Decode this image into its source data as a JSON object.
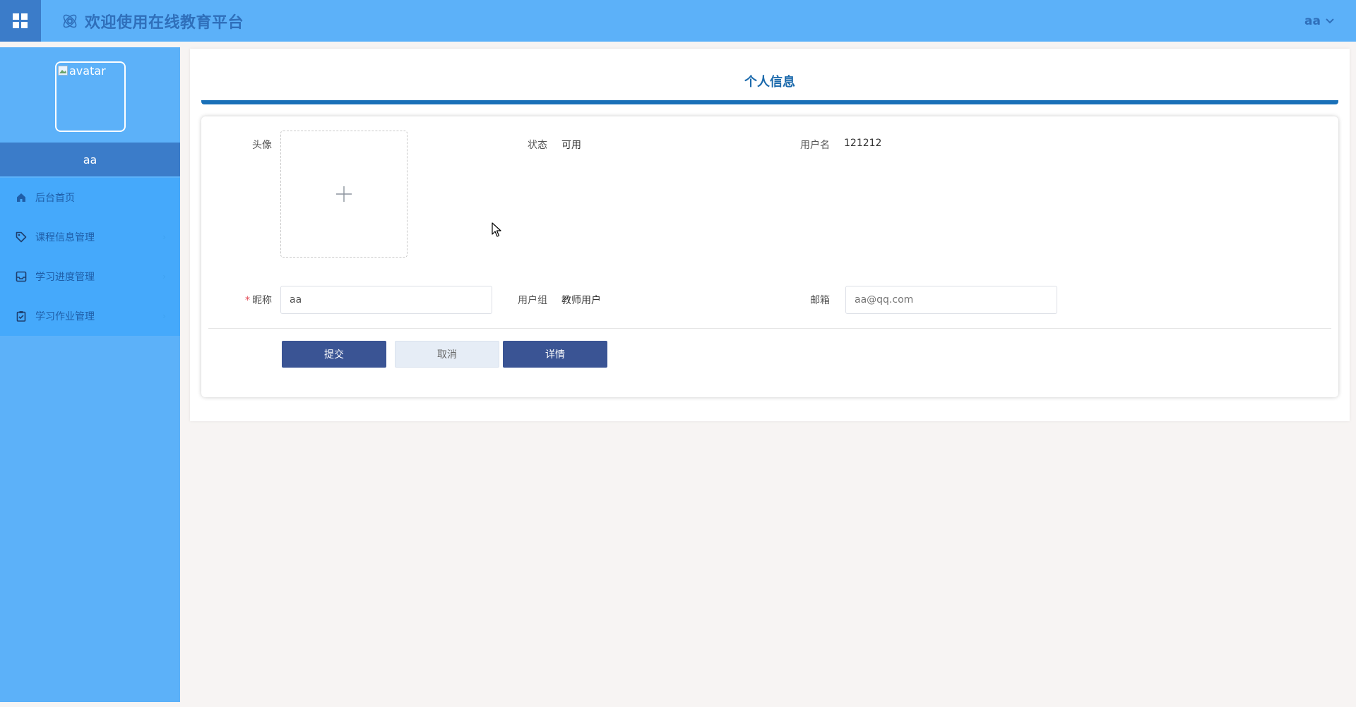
{
  "header": {
    "title": "欢迎使用在线教育平台",
    "user": "aa"
  },
  "sidebar": {
    "avatar_alt": "avatar",
    "username": "aa",
    "items": [
      {
        "label": "后台首页",
        "icon": "home-icon"
      },
      {
        "label": "课程信息管理",
        "icon": "tag-icon"
      },
      {
        "label": "学习进度管理",
        "icon": "inbox-icon"
      },
      {
        "label": "学习作业管理",
        "icon": "clipboard-check-icon"
      }
    ]
  },
  "main": {
    "page_title": "个人信息",
    "form": {
      "avatar_label": "头像",
      "status_label": "状态",
      "status_value": "可用",
      "username_label": "用户名",
      "username_value": "121212",
      "nickname_required": "*",
      "nickname_label": "昵称",
      "nickname_value": "aa",
      "group_label": "用户组",
      "group_value": "教师用户",
      "email_label": "邮箱",
      "email_placeholder": "aa@qq.com"
    },
    "buttons": {
      "submit": "提交",
      "cancel": "取消",
      "details": "详情"
    }
  },
  "colors": {
    "header_bg": "#5cb1f9",
    "accent_dark": "#3b7cc9",
    "title_blue": "#1c6aac",
    "button_primary": "#3a5494"
  }
}
